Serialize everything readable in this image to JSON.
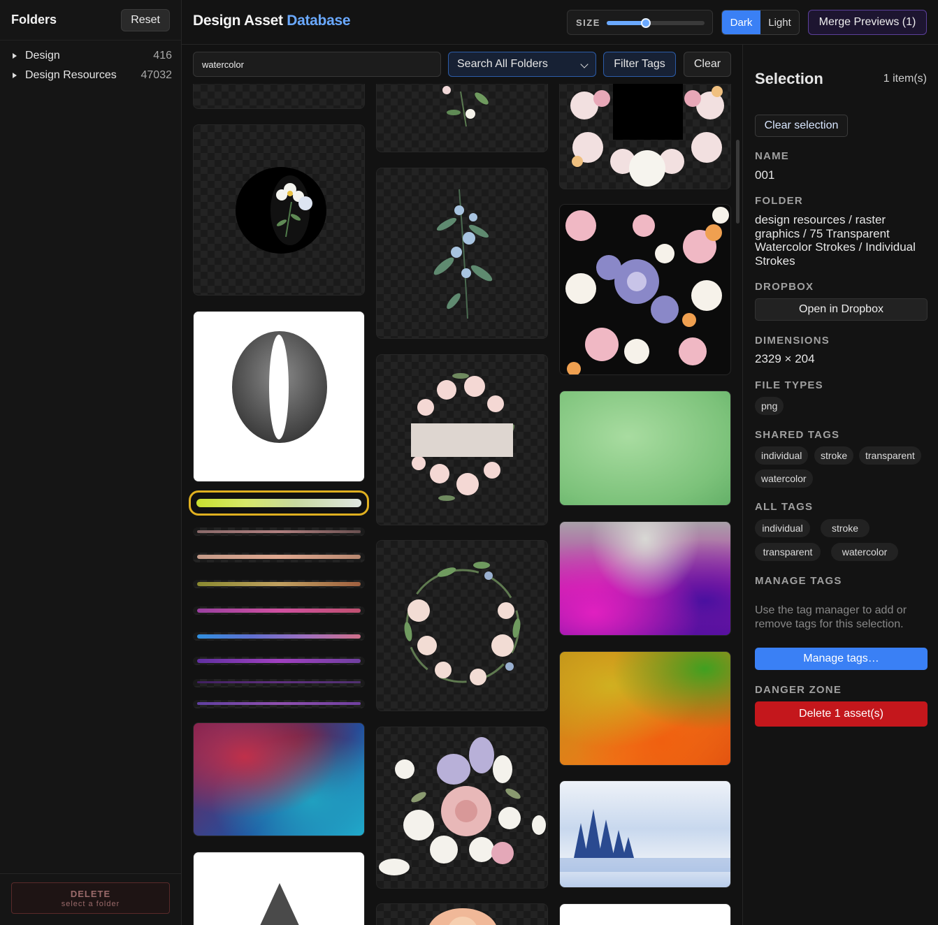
{
  "sidebar": {
    "title": "Folders",
    "reset_label": "Reset",
    "folders": [
      {
        "name": "Design",
        "count": "416"
      },
      {
        "name": "Design Resources",
        "count": "47032"
      }
    ],
    "delete_label": "DELETE",
    "delete_hint": "select a folder"
  },
  "header": {
    "title_main": "Design Asset",
    "title_accent": "Database",
    "size_label": "SIZE",
    "size_level_fraction": 0.4,
    "theme_dark": "Dark",
    "theme_light": "Light",
    "theme_active": "Dark",
    "merge_label": "Merge Previews (1)"
  },
  "search": {
    "query": "watercolor",
    "scope": "Search All Folders",
    "filter_label": "Filter Tags",
    "clear_label": "Clear"
  },
  "panel": {
    "title": "Selection",
    "count": "1 item(s)",
    "clear_selection": "Clear selection",
    "name_label": "NAME",
    "name": "001",
    "folder_label": "FOLDER",
    "folder": "design resources / raster graphics / 75 Transparent Watercolor Strokes / Individual Strokes",
    "dropbox_label": "DROPBOX",
    "dropbox_button": "Open in Dropbox",
    "dimensions_label": "DIMENSIONS",
    "dimensions": "2329 × 204",
    "filetypes_label": "FILE TYPES",
    "filetypes": [
      "png"
    ],
    "shared_tags_label": "SHARED TAGS",
    "shared_tags": [
      "individual",
      "stroke",
      "transparent",
      "watercolor"
    ],
    "all_tags_label": "ALL TAGS",
    "all_tags": [
      "individual",
      "stroke",
      "transparent",
      "watercolor"
    ],
    "manage_label": "MANAGE TAGS",
    "manage_hint": "Use the tag manager to add or remove tags for this selection.",
    "manage_button": "Manage tags…",
    "danger_label": "DANGER ZONE",
    "delete_button": "Delete 1 asset(s)"
  },
  "colors": {
    "accent": "#3a80f5",
    "title_accent": "#6aa9ff",
    "danger": "#c4171c",
    "selected_outline": "#e0b020"
  }
}
